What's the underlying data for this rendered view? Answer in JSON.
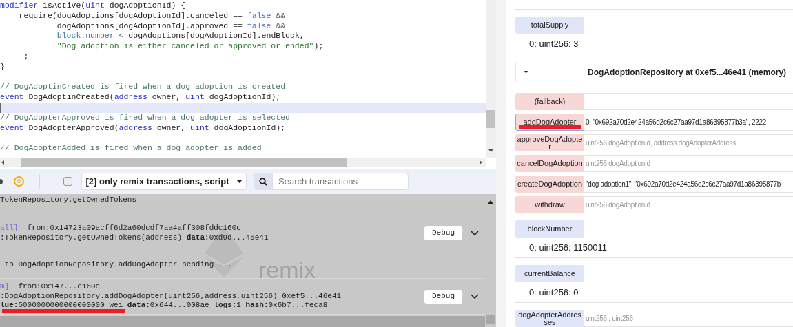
{
  "editor": {
    "lines": [
      {
        "highlighted": false,
        "tokens": [
          {
            "kind": "keyword",
            "text": "modifier"
          },
          {
            "kind": "plain",
            "text": " isActive("
          },
          {
            "kind": "keyword",
            "text": "uint"
          },
          {
            "kind": "plain",
            "text": " dogAdoptionId) {"
          }
        ]
      },
      {
        "highlighted": false,
        "tokens": [
          {
            "kind": "plain",
            "text": "    require(dogAdoptions[dogAdoptionId].canceled "
          },
          {
            "kind": "operator",
            "text": "=="
          },
          {
            "kind": "literal",
            "text": " false"
          },
          {
            "kind": "operator",
            "text": " &&"
          }
        ]
      },
      {
        "highlighted": false,
        "tokens": [
          {
            "kind": "plain",
            "text": "            dogAdoptions[dogAdoptionId].approved "
          },
          {
            "kind": "operator",
            "text": "=="
          },
          {
            "kind": "literal",
            "text": " false"
          },
          {
            "kind": "operator",
            "text": " &&"
          }
        ]
      },
      {
        "highlighted": false,
        "tokens": [
          {
            "kind": "builtin",
            "text": "            block.number"
          },
          {
            "kind": "operator",
            "text": " <"
          },
          {
            "kind": "plain",
            "text": " dogAdoptions[dogAdoptionId].endBlock,"
          }
        ]
      },
      {
        "highlighted": false,
        "tokens": [
          {
            "kind": "string",
            "text": "            \"Dog adoption is either canceled or approved or ended\""
          },
          {
            "kind": "plain",
            "text": ");"
          }
        ]
      },
      {
        "highlighted": false,
        "tokens": [
          {
            "kind": "keyword",
            "text": "    _"
          },
          {
            "kind": "plain",
            "text": ";"
          }
        ]
      },
      {
        "highlighted": false,
        "tokens": [
          {
            "kind": "plain",
            "text": "}"
          }
        ]
      },
      {
        "highlighted": false
      },
      {
        "highlighted": false,
        "tokens": [
          {
            "kind": "comment",
            "text": "// DogAdoptinCreated is fired when a dog adoption is created"
          }
        ]
      },
      {
        "highlighted": false,
        "tokens": [
          {
            "kind": "keyword",
            "text": "event"
          },
          {
            "kind": "plain",
            "text": " DogAdoptinCreated("
          },
          {
            "kind": "keyword",
            "text": "address"
          },
          {
            "kind": "plain",
            "text": " owner, "
          },
          {
            "kind": "keyword",
            "text": "uint"
          },
          {
            "kind": "plain",
            "text": " dogAdoptionId);"
          }
        ]
      },
      {
        "highlighted": true
      },
      {
        "highlighted": false,
        "tokens": [
          {
            "kind": "comment",
            "text": "// DogAdopterApproved is fired when a dog adopter is selected"
          }
        ]
      },
      {
        "highlighted": false,
        "tokens": [
          {
            "kind": "keyword",
            "text": "event"
          },
          {
            "kind": "plain",
            "text": " DogAdopterApproved("
          },
          {
            "kind": "keyword",
            "text": "address"
          },
          {
            "kind": "plain",
            "text": " owner, "
          },
          {
            "kind": "keyword",
            "text": "uint"
          },
          {
            "kind": "plain",
            "text": " dogAdoptionId);"
          }
        ]
      },
      {
        "highlighted": false
      },
      {
        "highlighted": false,
        "tokens": [
          {
            "kind": "comment",
            "text": "// DogAdopterAdded is fired when a dog adopter is added"
          }
        ]
      }
    ]
  },
  "terminal": {
    "pending_count": "0",
    "filter_checked": false,
    "filter": "[2] only remix transactions, script",
    "search": {
      "placeholder": "Search transactions"
    },
    "watermark": "remix",
    "rows": [
      {
        "lines": [
          [
            {
              "kind": "plain",
              "text": "TokenRepository.getOwnedTokens"
            }
          ]
        ]
      },
      {
        "debug_label": "Debug",
        "lines": [
          [
            {
              "kind": "tag",
              "text": "all]"
            },
            {
              "kind": "plain",
              "text": "  from:0x14723a09acff6d2a60dcdf7aa4aff308fddc160c"
            }
          ],
          [
            {
              "kind": "plain",
              "text": ":TokenRepository.getOwnedTokens(address) "
            },
            {
              "kind": "key",
              "text": "data:"
            },
            {
              "kind": "plain",
              "text": "0xd9d...46e41"
            }
          ]
        ]
      },
      {
        "lines": [
          [
            {
              "kind": "plain",
              "text": " to DogAdoptionRepository.addDogAdopter pending ..."
            }
          ]
        ]
      },
      {
        "debug_label": "Debug",
        "lines": [
          [
            {
              "kind": "tag",
              "text": "m]"
            },
            {
              "kind": "plain",
              "text": "  from:0x147...c160c"
            }
          ],
          [
            {
              "kind": "plain",
              "text": ":DogAdoptionRepository.addDogAdopter(uint256,address,uint256) 0xef5...46e41"
            }
          ],
          [
            {
              "kind": "key",
              "text": "lue:"
            },
            {
              "kind": "plain",
              "text": "5000000000000000000 wei "
            },
            {
              "kind": "key",
              "text": "data:"
            },
            {
              "kind": "plain",
              "text": "0x644...008ae "
            },
            {
              "kind": "key",
              "text": "logs:"
            },
            {
              "kind": "plain",
              "text": "1 "
            },
            {
              "kind": "key",
              "text": "hash:"
            },
            {
              "kind": "plain",
              "text": "0x6b7...feca8"
            }
          ]
        ]
      }
    ]
  },
  "deploy_panel": {
    "items": [
      {
        "kind": "call",
        "label": "totalSupply",
        "output": "0: uint256: 3"
      },
      {
        "kind": "instance",
        "label": "DogAdoptionRepository at 0xef5...46e41 (memory)",
        "expanded": true
      },
      {
        "kind": "transact",
        "label": "(fallback)",
        "focused": false
      },
      {
        "kind": "transact",
        "label": "addDogAdopter",
        "value": "0, \"0x692a70d2e424a56d2c6c27aa97d1a86395877b3a\", 2222",
        "focused": true
      },
      {
        "kind": "transact",
        "label": "approveDogAdopter",
        "placeholder": "uint256 dogAdoptionId, address dogAdopterAddress",
        "focused": false
      },
      {
        "kind": "transact",
        "label": "cancelDogAdoption",
        "placeholder": "uint256 dogAdoptionId",
        "focused": false
      },
      {
        "kind": "transact",
        "label": "createDogAdoption",
        "value": "\"dog adoption1\", \"0x692a70d2e424a56d2c6c27aa97d1a86395877b",
        "focused": false
      },
      {
        "kind": "transact",
        "label": "withdraw",
        "placeholder": "uint256 dogAdoptionId",
        "focused": false
      },
      {
        "kind": "call",
        "label": "blockNumber",
        "output": "0: uint256: 1150011"
      },
      {
        "kind": "call",
        "label": "currentBalance",
        "output": "0: uint256: 0"
      },
      {
        "kind": "call",
        "label": "dogAdopterAddresses",
        "placeholder": "uint256 , uint256"
      }
    ]
  }
}
